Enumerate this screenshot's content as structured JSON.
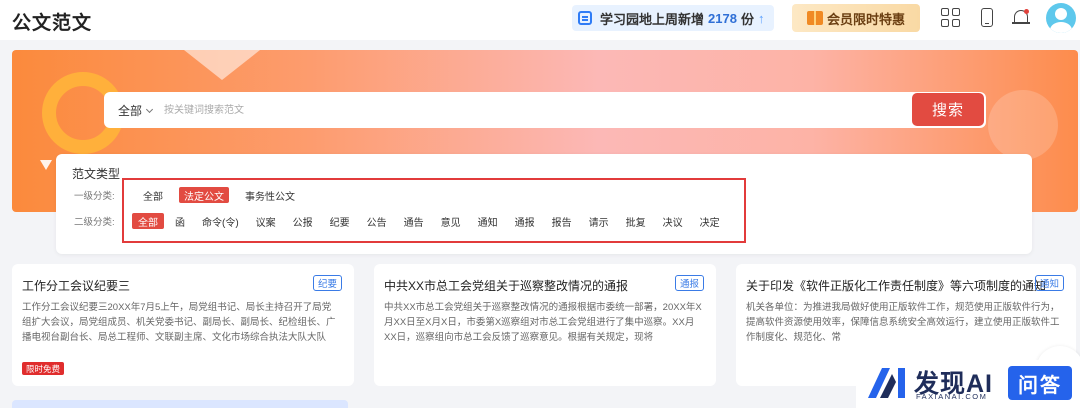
{
  "header": {
    "logo": "公文范文",
    "notice_prefix": "学习园地上周新增",
    "notice_count": "2178",
    "notice_unit": "份",
    "vip_label": "会员限时特惠"
  },
  "search": {
    "scope": "全部",
    "placeholder": "按关键词搜索范文",
    "button": "搜索"
  },
  "filter": {
    "title": "范文类型",
    "level1_label": "一级分类:",
    "level2_label": "二级分类:",
    "level1": [
      "全部",
      "法定公文",
      "事务性公文"
    ],
    "level2": [
      "全部",
      "函",
      "命令(令)",
      "议案",
      "公报",
      "纪要",
      "公告",
      "通告",
      "意见",
      "通知",
      "通报",
      "报告",
      "请示",
      "批复",
      "决议",
      "决定"
    ]
  },
  "cards": [
    {
      "title": "工作分工会议纪要三",
      "tag": "纪要",
      "body": "工作分工会议纪要三20XX年7月5上午，局党组书记、局长主持召开了局党组扩大会议，局党组成员、机关党委书记、副局长、副局长、纪检组长、广播电视台副台长、局总工程师、文联副主席、文化市场综合执法大队大队",
      "badge": "限时免费"
    },
    {
      "title": "中共XX市总工会党组关于巡察整改情况的通报",
      "tag": "通报",
      "body": "中共XX市总工会党组关于巡察整改情况的通报根据市委统一部署，20XX年X月XX日至X月X日，市委第X巡察组对市总工会党组进行了集中巡察。XX月XX日，巡察组向市总工会反馈了巡察意见。根据有关规定，现将"
    },
    {
      "title": "关于印发《软件正版化工作责任制度》等六项制度的通知",
      "tag": "通知",
      "body": "机关各单位：为推进我局做好使用正版软件工作，规范使用正版软件行为，提高软件资源使用效率，保障信息系统安全高效运行，建立使用正版软件工作制度化、规范化、常"
    }
  ],
  "watermark": {
    "brand": "发现AI",
    "sub": "FAXIANAI.COM",
    "ask": "问答"
  }
}
